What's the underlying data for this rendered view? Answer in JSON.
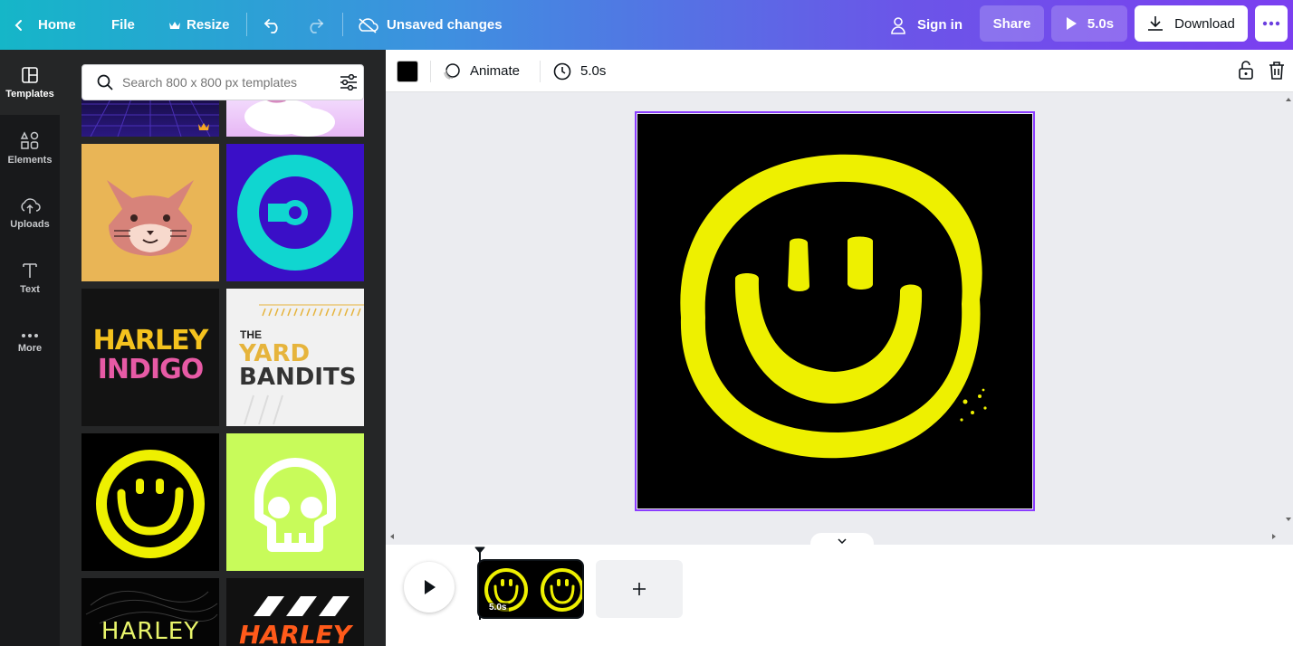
{
  "topbar": {
    "home": "Home",
    "file": "File",
    "resize": "Resize",
    "save_status": "Unsaved changes",
    "sign_in": "Sign in",
    "share": "Share",
    "duration": "5.0s",
    "download": "Download"
  },
  "rail": [
    {
      "label": "Templates",
      "icon": "templates-icon"
    },
    {
      "label": "Elements",
      "icon": "elements-icon"
    },
    {
      "label": "Uploads",
      "icon": "uploads-icon"
    },
    {
      "label": "Text",
      "icon": "text-icon"
    },
    {
      "label": "More",
      "icon": "more-icon"
    }
  ],
  "search": {
    "placeholder": "Search 800 x 800 px templates"
  },
  "templates": {
    "harley_indigo_top": "HARLEY",
    "harley_indigo_bottom": "INDIGO",
    "yard_the": "THE",
    "yard_yard": "YARD",
    "yard_bandits": "BANDITS",
    "harley_outline": "HARLEY",
    "harley_orange": "HARLEY"
  },
  "toolbar": {
    "color": "#000000",
    "animate": "Animate",
    "duration": "5.0s"
  },
  "timeline": {
    "page_duration": "5.0s"
  },
  "colors": {
    "accent": "#8b3dff",
    "smiley_yellow": "#eef000"
  }
}
